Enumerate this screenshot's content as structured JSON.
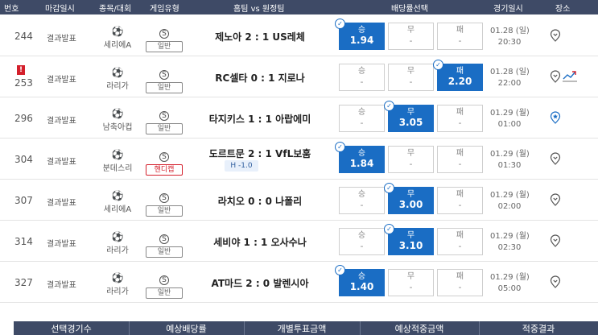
{
  "header": {
    "number": "번호",
    "deadline": "마감일시",
    "league": "종목/대회",
    "game_type": "게임유형",
    "matchup": "홈팀 vs 원정팀",
    "odds_select": "배당률선택",
    "game_datetime": "경기일시",
    "venue": "장소"
  },
  "labels": {
    "win": "승",
    "draw": "무",
    "lose": "패",
    "dash": "-",
    "s": "S"
  },
  "colors": {
    "header_bg": "#3e4a66",
    "selected": "#1a6dc4",
    "warning": "#d4202c",
    "handicap": "#d4202c"
  },
  "rows": [
    {
      "number": "244",
      "status": "결과발표",
      "league": "세리에A",
      "type": "일반",
      "match": "제노아 2 : 1 US레체",
      "win": "1.94",
      "draw": "-",
      "lose": "-",
      "selected": "win",
      "date": "01.28 (일)",
      "time": "20:30",
      "icon": "pin-icon"
    },
    {
      "number": "253",
      "status": "결과발표",
      "league": "라리가",
      "type": "일반",
      "match": "RC셀타 0 : 1 지로나",
      "win": "-",
      "draw": "-",
      "lose": "2.20",
      "selected": "lose",
      "date": "01.28 (일)",
      "time": "22:00",
      "icon": "pin-icon",
      "warning": "!"
    },
    {
      "number": "296",
      "status": "결과발표",
      "league": "남축아컵",
      "type": "일반",
      "match": "타지키스 1 : 1 아랍에미",
      "win": "-",
      "draw": "3.05",
      "lose": "-",
      "selected": "draw",
      "date": "01.29 (월)",
      "time": "01:00",
      "icon": "star-pin-icon"
    },
    {
      "number": "304",
      "status": "결과발표",
      "league": "분데스리",
      "type": "핸디캡",
      "match": "도르트문 2 : 1 VfL보훔",
      "handicap": "H -1.0",
      "win": "1.84",
      "draw": "-",
      "lose": "-",
      "selected": "win",
      "date": "01.29 (월)",
      "time": "01:30",
      "icon": "pin-icon"
    },
    {
      "number": "307",
      "status": "결과발표",
      "league": "세리에A",
      "type": "일반",
      "match": "라치오 0 : 0 나폴리",
      "win": "-",
      "draw": "3.00",
      "lose": "-",
      "selected": "draw",
      "date": "01.29 (월)",
      "time": "02:00",
      "icon": "pin-icon"
    },
    {
      "number": "314",
      "status": "결과발표",
      "league": "라리가",
      "type": "일반",
      "match": "세비야 1 : 1 오사수나",
      "win": "-",
      "draw": "3.10",
      "lose": "-",
      "selected": "draw",
      "date": "01.29 (월)",
      "time": "02:30",
      "icon": "pin-icon"
    },
    {
      "number": "327",
      "status": "결과발표",
      "league": "라리가",
      "type": "일반",
      "match": "AT마드 2 : 0 발렌시아",
      "win": "1.40",
      "draw": "-",
      "lose": "-",
      "selected": "win",
      "date": "01.29 (월)",
      "time": "05:00",
      "icon": "pin-icon"
    }
  ],
  "footer": {
    "selected_games": "선택경기수",
    "expected_odds": "예상배당률",
    "individual_bet": "개별투표금액",
    "expected_payout": "예상적중금액",
    "hit_result": "적중결과"
  }
}
